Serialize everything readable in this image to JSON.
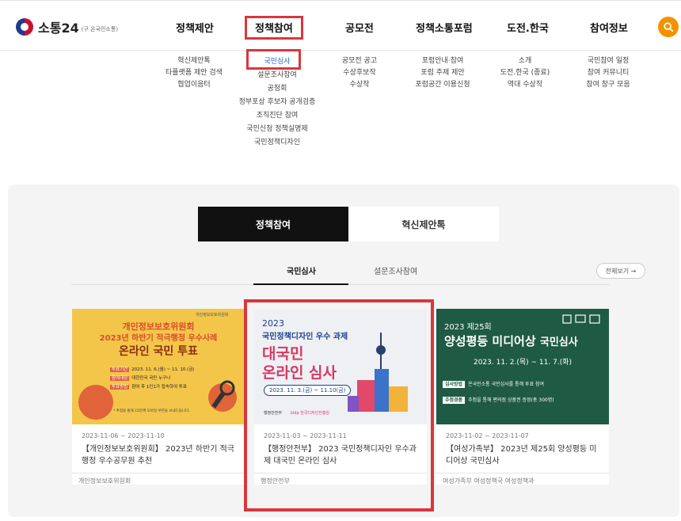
{
  "header": {
    "logo_text": "소통24",
    "logo_sub": "(구 온국민소통)",
    "nav": [
      "정책제안",
      "정책참여",
      "공모전",
      "정책소통포럼",
      "도전.한국",
      "참여정보"
    ],
    "accent": "#f39200",
    "highlight": "#d9363e"
  },
  "submenus": {
    "proposal": [
      "혁신제안톡",
      "타플랫폼 제안 검색",
      "협업이음터"
    ],
    "participation": [
      "국민심사",
      "설문조사참여",
      "공청회",
      "정부포상 후보자 공개검증",
      "조직진단 참여",
      "국민신청 정책실명제",
      "국민정책디자인"
    ],
    "contest": [
      "공모전 공고",
      "수상후보작",
      "수상작"
    ],
    "forum": [
      "포럼안내·참여",
      "포럼 주제 제안",
      "포럼공간 이용신청"
    ],
    "challenge": [
      "소개",
      "도전.한국 (종료)",
      "역대 수상작"
    ],
    "info": [
      "국민참여 일정",
      "참여 커뮤니티",
      "참여 창구 모음"
    ]
  },
  "section": {
    "tabs": [
      "정책참여",
      "혁신제안톡"
    ],
    "subtabs": [
      "국민심사",
      "설문조사참여"
    ],
    "view_all": "전체보기 →"
  },
  "cards": [
    {
      "date": "2023-11-06 ~ 2023-11-10",
      "title": "【개인정보보호위원회】 2023년 하반기 적극행정 우수공무원 추천",
      "org": "개인정보보호위원회",
      "banner": {
        "top": "개인정보보호위원회",
        "line1": "2023년 하반기 적극행정 우수사례",
        "line2": "온라인 국민 투표",
        "rows": [
          [
            "투표기간",
            "2023. 11. 6.(월) ~ 11. 10.(금)"
          ],
          [
            "참여대상",
            "대한민국 국민 누구나"
          ],
          [
            "투표방법",
            "참여 후 1인1가 접속하여 투표"
          ]
        ],
        "note": "* 추첨을 통해 15분께 모바일 쿠폰을 보내드립니다."
      }
    },
    {
      "date": "2023-11-03 ~ 2023-11-11",
      "title": "【행정안전부】 2023 국민정책디자인 우수과제 대국민 온라인 심사",
      "org": "행정안전부",
      "banner": {
        "year": "2023",
        "line1": "국민정책디자인 우수 과제",
        "line2": "대국민",
        "line3": "온라인 심사",
        "period": "2023. 11. 3.(금) ~ 11.10(금)",
        "org1": "행정안전부",
        "org2": "kidp 한국디자인진흥원"
      }
    },
    {
      "date": "2023-11-02 ~ 2023-11-07",
      "title": "【여성가족부】 2023년 제25회 양성평등 미디어상 국민심사",
      "org": "여성가족부 여성정책국 여성정책과",
      "banner": {
        "year": "2023 제25회",
        "line1": "양성평등 미디어상",
        "line1b": "국민심사",
        "period": "2023. 11. 2.(목) ~ 11. 7.(화)",
        "rows": [
          [
            "심사방법",
            "온국민소통 국민심사를 통해 투표 참여"
          ],
          [
            "추첨경품",
            "추첨을 통해 편의점 상품권 증정(총 300명)"
          ]
        ]
      }
    }
  ]
}
